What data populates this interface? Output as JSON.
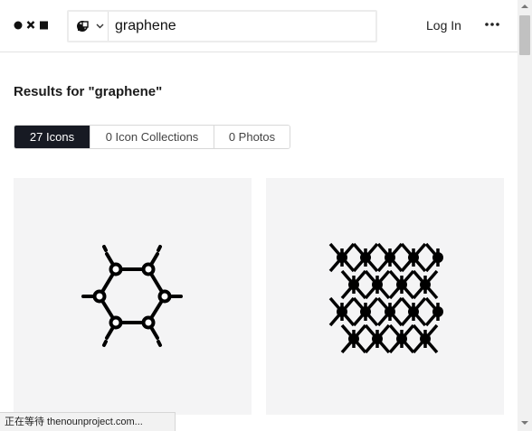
{
  "header": {
    "logo_icon": "noun-project-logo-icon",
    "search_type_icon": "icons-type-icon",
    "search_value": "graphene",
    "login_label": "Log In",
    "more_icon": "more-horizontal-icon"
  },
  "results": {
    "title": "Results for \"graphene\""
  },
  "tabs": [
    {
      "label": "27 Icons",
      "active": true
    },
    {
      "label": "0 Icon Collections",
      "active": false
    },
    {
      "label": "0 Photos",
      "active": false
    }
  ],
  "cards": [
    {
      "icon": "graphene-hexagon-icon"
    },
    {
      "icon": "graphene-lattice-icon"
    }
  ],
  "status_bar": {
    "text": "正在等待 thenounproject.com..."
  },
  "colors": {
    "active_tab_bg": "#171a23",
    "card_bg": "#f4f4f5"
  }
}
